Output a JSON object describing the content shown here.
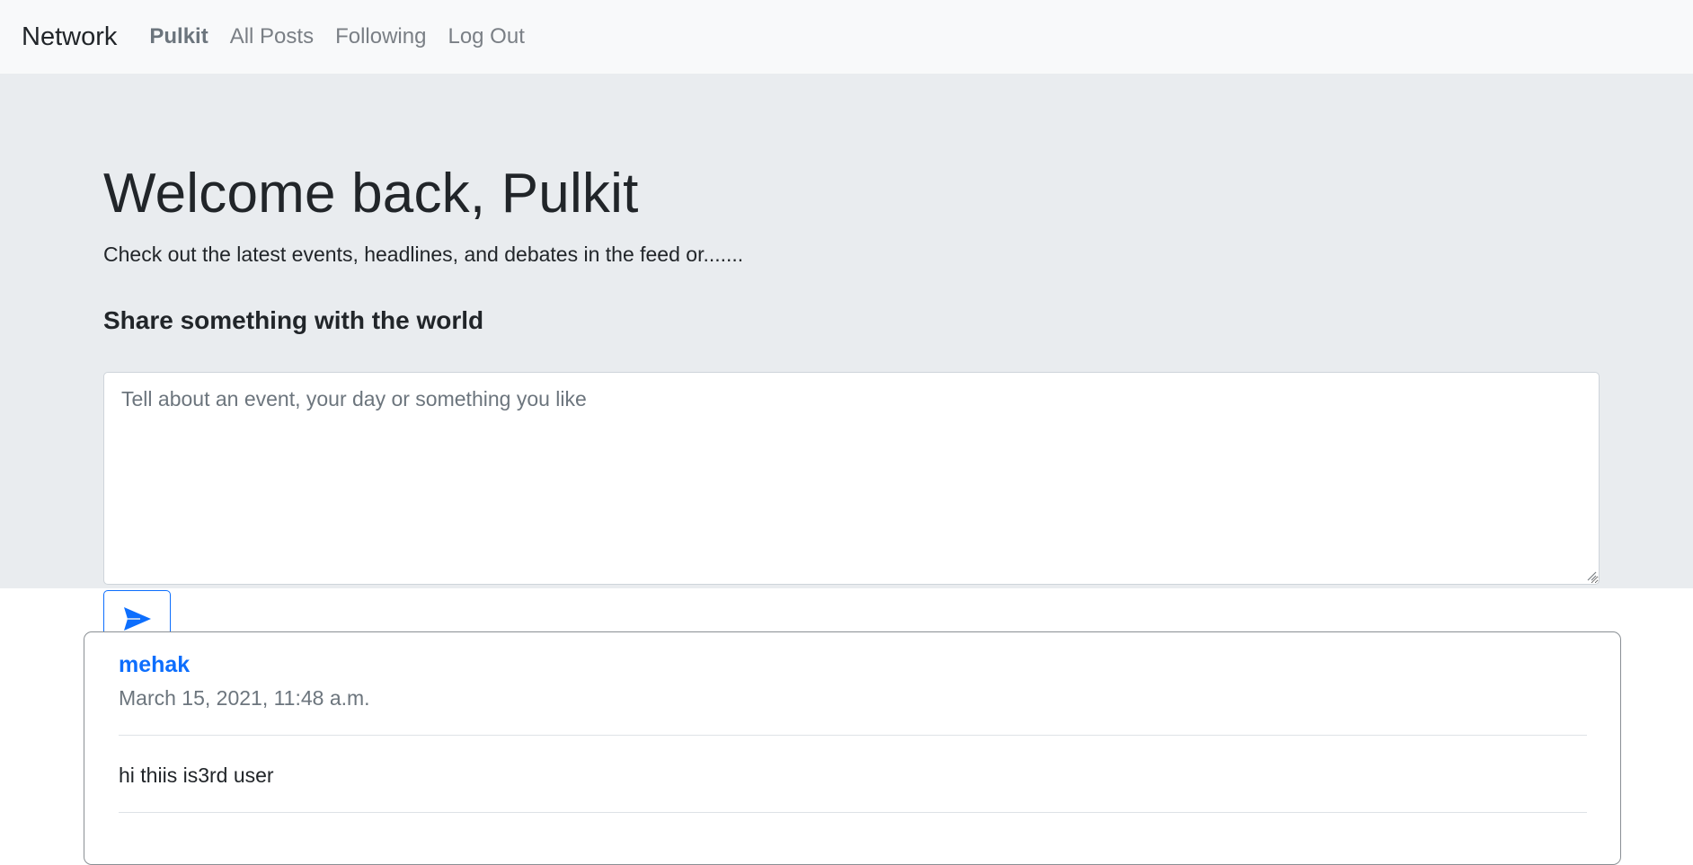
{
  "navbar": {
    "brand": "Network",
    "links": [
      {
        "label": "Pulkit",
        "active": true
      },
      {
        "label": "All Posts",
        "active": false
      },
      {
        "label": "Following",
        "active": false
      },
      {
        "label": "Log Out",
        "active": false
      }
    ]
  },
  "hero": {
    "title": "Welcome back, Pulkit",
    "lead": "Check out the latest events, headlines, and debates in the feed or.......",
    "share_heading": "Share something with the world",
    "textarea_placeholder": "Tell about an event, your day or something you like",
    "send_icon": "send-icon"
  },
  "feed": {
    "posts": [
      {
        "author": "mehak",
        "timestamp": "March 15, 2021, 11:48 a.m.",
        "content": "hi thiis is3rd user"
      }
    ]
  },
  "colors": {
    "accent": "#0d6efd",
    "navbar_bg": "#f8f9fa",
    "jumbotron_bg": "#e9ecef",
    "muted_text": "#6c757d"
  }
}
